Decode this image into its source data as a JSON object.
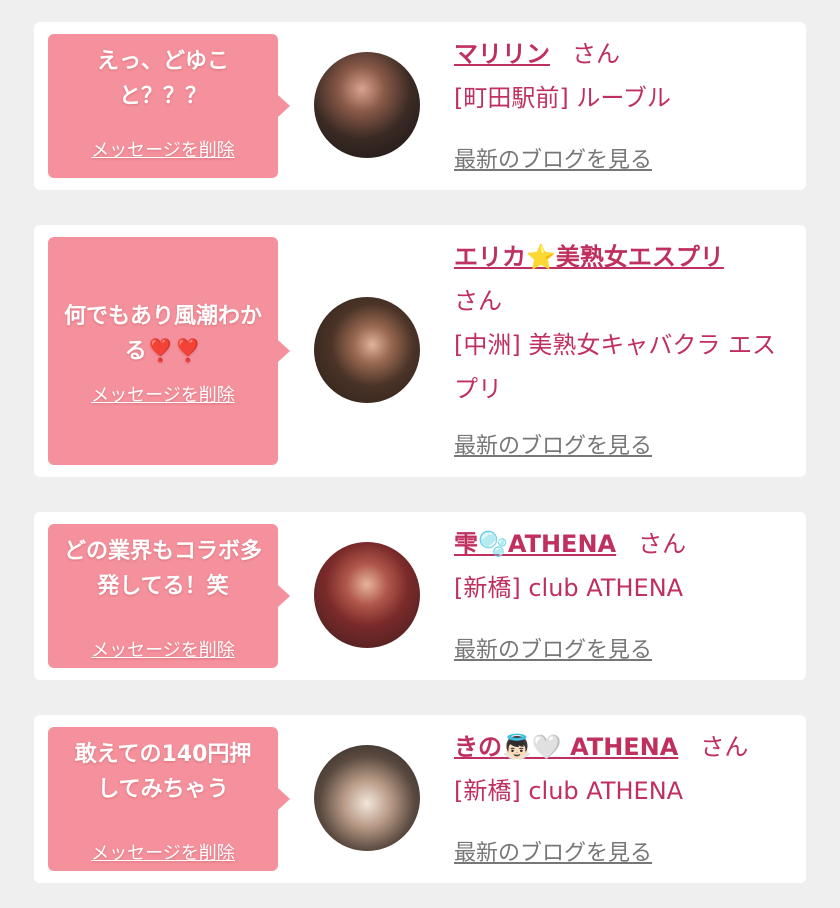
{
  "cards": [
    {
      "message": "えっ、どゆこと？？？",
      "delete_label": "メッセージを削除",
      "name": "マリリン",
      "honorific": "さん",
      "shop": "[町田駅前] ルーブル",
      "blog_label": "最新のブログを見る"
    },
    {
      "message": "何でもあり風潮わかる❣️❣️",
      "delete_label": "メッセージを削除",
      "name": "エリカ⭐美熟女エスプリ",
      "honorific": "さん",
      "shop": "[中洲] 美熟女キャバクラ エスプリ",
      "blog_label": "最新のブログを見る"
    },
    {
      "message": "どの業界もコラボ多発してる！笑",
      "delete_label": "メッセージを削除",
      "name": "雫🫧ATHENA",
      "honorific": "さん",
      "shop": "[新橋] club ATHENA",
      "blog_label": "最新のブログを見る"
    },
    {
      "message": "敢えての140円押してみちゃう",
      "delete_label": "メッセージを削除",
      "name": "きの👼🏻🤍 ATHENA",
      "honorific": "さん",
      "shop": "[新橋] club ATHENA",
      "blog_label": "最新のブログを見る"
    }
  ],
  "colors": {
    "bubble": "#f5919c",
    "accent": "#c0305e",
    "background": "#efefef",
    "link_gray": "#777777"
  }
}
